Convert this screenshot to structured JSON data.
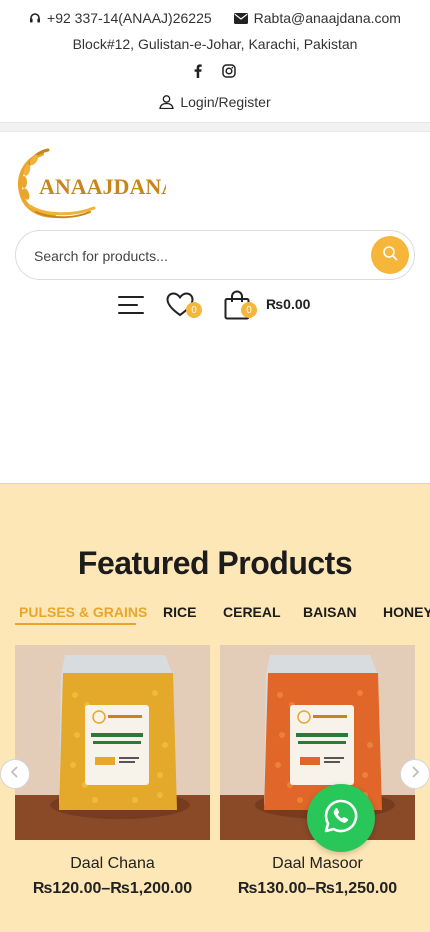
{
  "topbar": {
    "phone": "+92 337-14(ANAAJ)26225",
    "email": "Rabta@anaajdana.com",
    "address": "Block#12, Gulistan-e-Johar, Karachi, Pakistan",
    "social": [
      "facebook-icon",
      "instagram-icon"
    ],
    "login_label": "Login/Register"
  },
  "brand": {
    "logo_text": "ANAAJDANA",
    "accent": "#f5b63a"
  },
  "search": {
    "placeholder": "Search for products..."
  },
  "header": {
    "wishlist_count": "0",
    "cart_count": "0",
    "cart_total": "₨0.00"
  },
  "featured": {
    "title": "Featured Products",
    "tabs": [
      "PULSES & GRAINS",
      "RICE",
      "CEREAL",
      "BAISAN",
      "HONEY"
    ],
    "active_tab": 0,
    "products": [
      {
        "name": "Daal Chana",
        "price": "₨120.00–₨1,200.00"
      },
      {
        "name": "Daal Masoor",
        "price": "₨130.00–₨1,250.00"
      }
    ]
  },
  "colors": {
    "featured_bg": "#fde7b6",
    "active_tab": "#e9a62a",
    "whatsapp": "#29c65a"
  }
}
